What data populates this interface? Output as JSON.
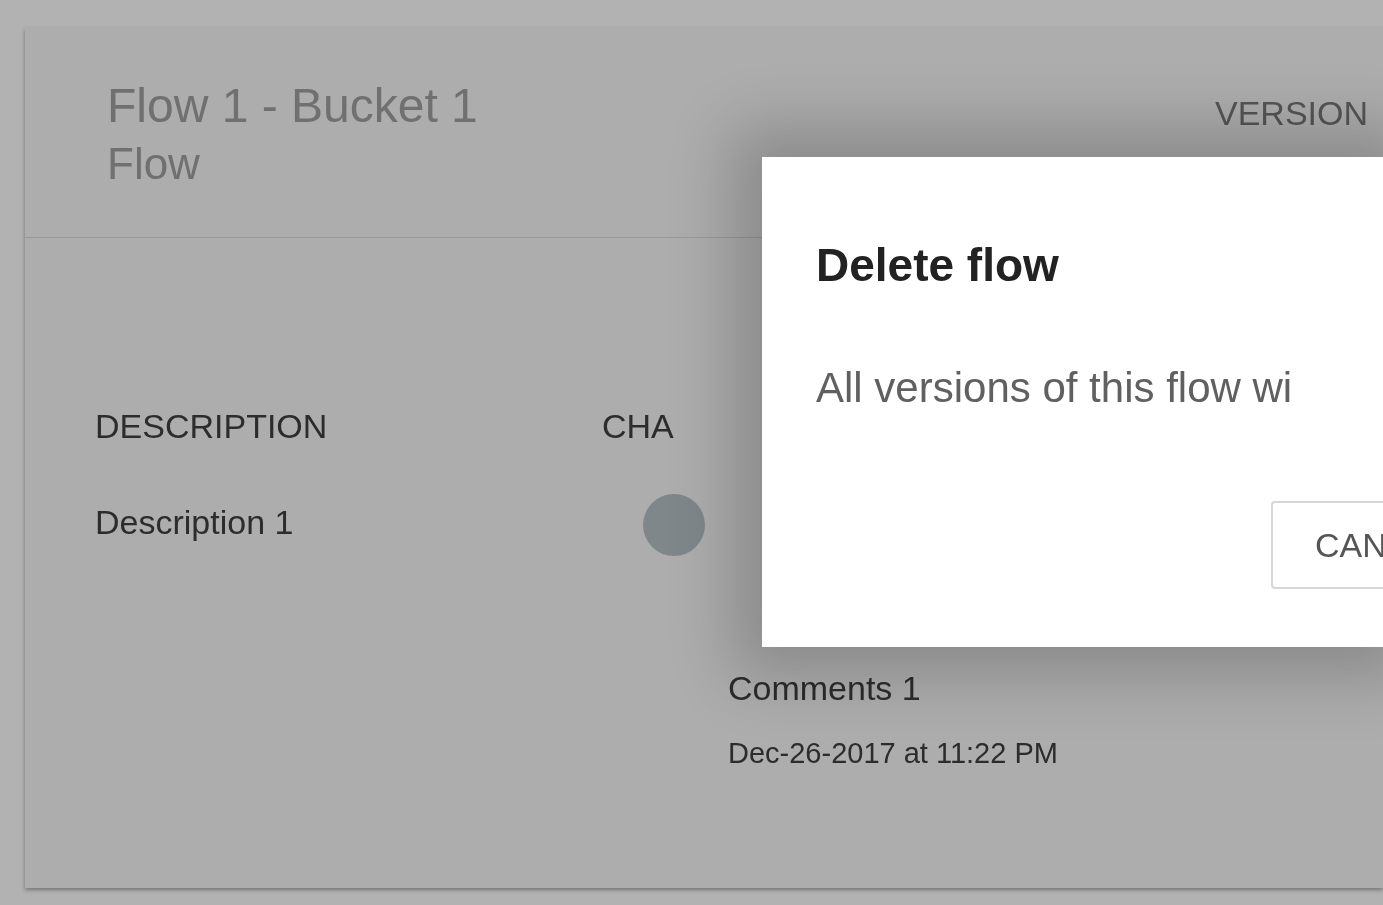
{
  "flow_card": {
    "title": "Flow 1 - Bucket 1",
    "subtitle": "Flow",
    "versions_label": "VERSION",
    "description": {
      "label": "DESCRIPTION",
      "value": "Description 1"
    },
    "changes": {
      "label": "CHA",
      "comment": "Comments 1",
      "date": "Dec-26-2017 at 11:22 PM"
    }
  },
  "dialog": {
    "title": "Delete flow",
    "message": "All versions of this flow wi",
    "buttons": [
      "CAN"
    ]
  }
}
